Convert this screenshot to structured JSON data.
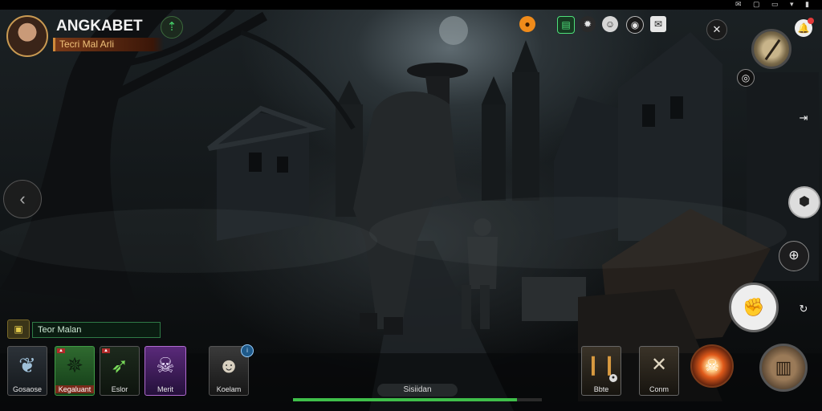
{
  "status_bar": {
    "icons": [
      "notification-icon",
      "photo-icon",
      "screen-icon",
      "wifi-icon",
      "battery-icon"
    ]
  },
  "player": {
    "name": "ANGKABET",
    "subtitle": "Tecri Mal Arli"
  },
  "tag": {
    "label": "Teor Malan"
  },
  "skills": [
    {
      "label": "Gosaose",
      "icon": "feather-icon"
    },
    {
      "label": "Kegaluant",
      "icon": "beast-icon",
      "badge": "▲"
    },
    {
      "label": "Eslor",
      "icon": "arrows-icon",
      "badge": "▲"
    },
    {
      "label": "Merit",
      "icon": "skull-mask-icon"
    },
    {
      "label": "Koelam",
      "icon": "clown-icon"
    }
  ],
  "center_label": "Sisiidan",
  "xp_progress": 0.9,
  "items": [
    {
      "label": "Bbte",
      "icon": "ammo-icon"
    },
    {
      "label": "Conm",
      "icon": "crossed-tools-icon"
    }
  ],
  "colors": {
    "accent_green": "#3fbf4a",
    "accent_orange": "#f08b1a",
    "badge_red": "#b12a2a"
  }
}
